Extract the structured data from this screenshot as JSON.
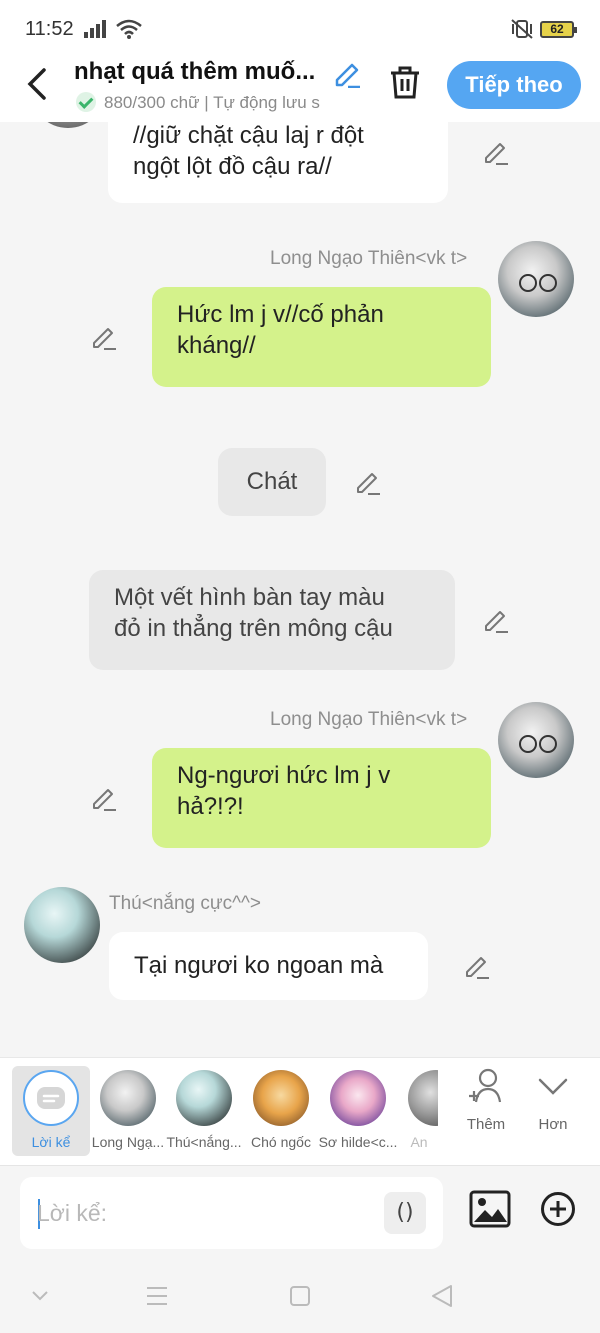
{
  "status_bar": {
    "time": "11:52",
    "battery": "62"
  },
  "header": {
    "title": "nhạt quá thêm muố...",
    "save_status": "880/300 chữ | Tự động lưu s",
    "next_button": "Tiếp theo"
  },
  "messages": [
    {
      "text_lines": [
        "//giữ chặt cậu laj r đột",
        "ngột lột đồ cậu ra//"
      ]
    },
    {
      "sender": "Long Ngạo Thiên<vk t>",
      "text_lines": [
        "Hức lm j v//cố phản",
        "kháng//"
      ]
    },
    {
      "text_lines": [
        "Chát"
      ]
    },
    {
      "text_lines": [
        "Một vết hình bàn tay màu",
        "đỏ in thẳng trên mông cậu"
      ]
    },
    {
      "sender": "Long Ngạo Thiên<vk t>",
      "text_lines": [
        "Ng-ngươi hức lm j v",
        "hả?!?!"
      ]
    },
    {
      "sender": "Thú<nắng cực^^>",
      "text_lines": [
        "Tại ngươi ko ngoan mà"
      ]
    }
  ],
  "characters": [
    {
      "name": "Lời kể"
    },
    {
      "name": "Long Ngạ..."
    },
    {
      "name": "Thú<nắng..."
    },
    {
      "name": "Chó ngốc"
    },
    {
      "name": "Sơ hilde<c..."
    },
    {
      "name": "An"
    }
  ],
  "tools": {
    "more": "Thêm",
    "less": "Hơn"
  },
  "input": {
    "placeholder": "Lời kể:",
    "paren_button": "()"
  }
}
